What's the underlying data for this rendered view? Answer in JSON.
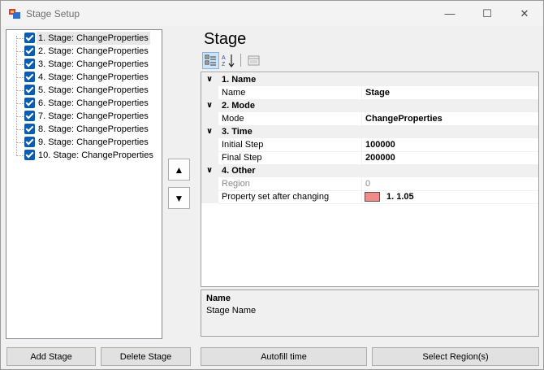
{
  "window": {
    "title": "Stage Setup",
    "minimize": "—",
    "maximize": "☐",
    "close": "✕"
  },
  "stage_tree": {
    "items": [
      {
        "label": "1. Stage: ChangeProperties",
        "checked": true,
        "selected": true
      },
      {
        "label": "2. Stage: ChangeProperties",
        "checked": true
      },
      {
        "label": "3. Stage: ChangeProperties",
        "checked": true
      },
      {
        "label": "4. Stage: ChangeProperties",
        "checked": true
      },
      {
        "label": "5. Stage: ChangeProperties",
        "checked": true
      },
      {
        "label": "6. Stage: ChangeProperties",
        "checked": true
      },
      {
        "label": "7. Stage: ChangeProperties",
        "checked": true
      },
      {
        "label": "8. Stage: ChangeProperties",
        "checked": true
      },
      {
        "label": "9. Stage: ChangeProperties",
        "checked": true
      },
      {
        "label": "10. Stage: ChangeProperties",
        "checked": true
      }
    ]
  },
  "move_buttons": {
    "up": "▲",
    "down": "▼"
  },
  "property_grid": {
    "title": "Stage",
    "categories": [
      {
        "label": "1. Name",
        "properties": [
          {
            "name": "Name",
            "value": "Stage"
          }
        ]
      },
      {
        "label": "2. Mode",
        "properties": [
          {
            "name": "Mode",
            "value": "ChangeProperties"
          }
        ]
      },
      {
        "label": "3. Time",
        "properties": [
          {
            "name": "Initial Step",
            "value": "100000"
          },
          {
            "name": "Final Step",
            "value": "200000"
          }
        ]
      },
      {
        "label": "4. Other",
        "properties": [
          {
            "name": "Region",
            "value": "0",
            "disabled": true
          },
          {
            "name": "Property set after changing",
            "value": "1. 1.05",
            "swatch_color": "#f28a8a"
          }
        ]
      }
    ]
  },
  "description": {
    "title": "Name",
    "body": "Stage Name"
  },
  "buttons": {
    "add_stage": "Add Stage",
    "delete_stage": "Delete Stage",
    "autofill_time": "Autofill time",
    "select_regions": "Select Region(s)"
  }
}
